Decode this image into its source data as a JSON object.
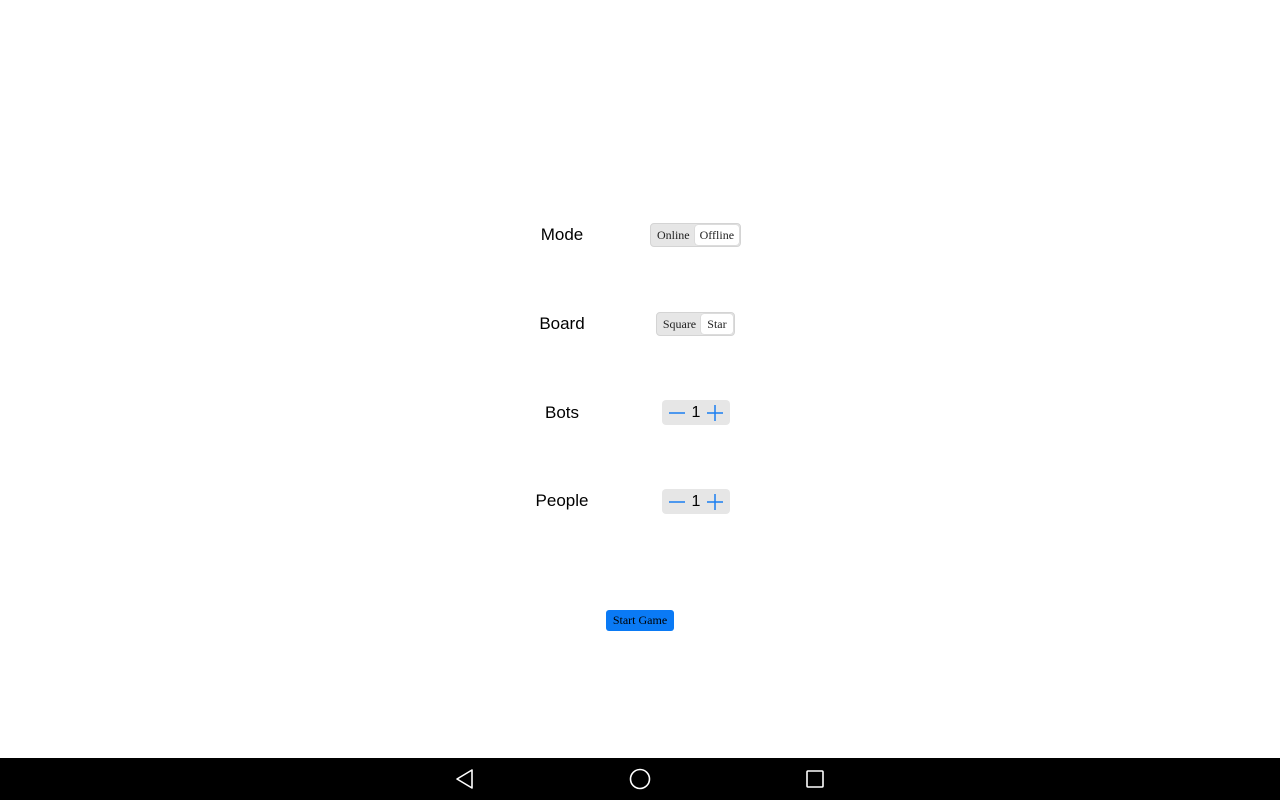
{
  "settings": {
    "mode": {
      "label": "Mode",
      "options": [
        "Online",
        "Offline"
      ],
      "selected": "Offline"
    },
    "board": {
      "label": "Board",
      "options": [
        "Square",
        "Star"
      ],
      "selected": "Star"
    },
    "bots": {
      "label": "Bots",
      "value": "1"
    },
    "people": {
      "label": "People",
      "value": "1"
    }
  },
  "start_button": {
    "label": "Start Game",
    "color": "#0a7af5"
  },
  "stepper": {
    "icon_color": "#1a7ff0",
    "decrement_icon": "minus-icon",
    "increment_icon": "plus-icon"
  },
  "nav_bar": {
    "back_icon": "back-triangle-icon",
    "home_icon": "home-circle-icon",
    "recents_icon": "recents-square-icon"
  }
}
